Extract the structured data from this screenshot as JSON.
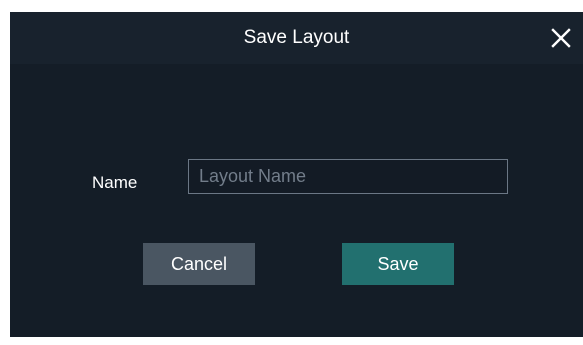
{
  "dialog": {
    "title": "Save Layout",
    "close_icon": "close-icon",
    "name_label": "Name",
    "name_input": {
      "value": "",
      "placeholder": "Layout Name"
    },
    "cancel_label": "Cancel",
    "save_label": "Save"
  },
  "colors": {
    "background": "#141d27",
    "titlebar": "#18222d",
    "input_border": "#6b7785",
    "cancel_button": "#4a5662",
    "save_button": "#22706f",
    "text": "#ffffff"
  }
}
